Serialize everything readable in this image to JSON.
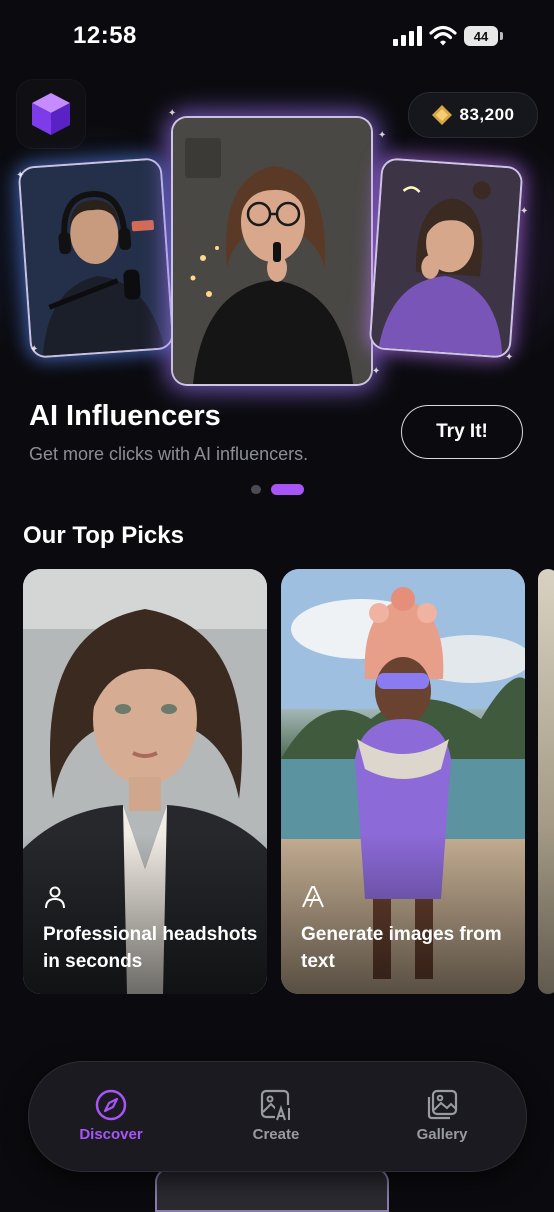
{
  "status_bar": {
    "time": "12:58",
    "battery": "44"
  },
  "header": {
    "app_logo_icon": "purple-cube-icon",
    "gems": {
      "icon": "gem-icon",
      "value": "83,200"
    }
  },
  "hero": {
    "title": "AI Influencers",
    "subtitle": "Get more clicks with AI influencers.",
    "cta_label": "Try It!",
    "cards": [
      "podcaster-avatar",
      "glasses-woman-avatar",
      "sweater-woman-avatar"
    ],
    "pager": {
      "total": 2,
      "active_index": 1
    }
  },
  "top_picks": {
    "title": "Our Top Picks",
    "items": [
      {
        "icon": "person-icon",
        "label": "Professional headshots in seconds"
      },
      {
        "icon": "text-a-icon",
        "label": "Generate images from text"
      }
    ]
  },
  "tab_bar": {
    "accent": "#a855f7",
    "tabs": [
      {
        "label": "Discover",
        "icon": "compass-icon",
        "active": true
      },
      {
        "label": "Create",
        "icon": "ai-image-icon",
        "active": false
      },
      {
        "label": "Gallery",
        "icon": "gallery-icon",
        "active": false
      }
    ]
  }
}
